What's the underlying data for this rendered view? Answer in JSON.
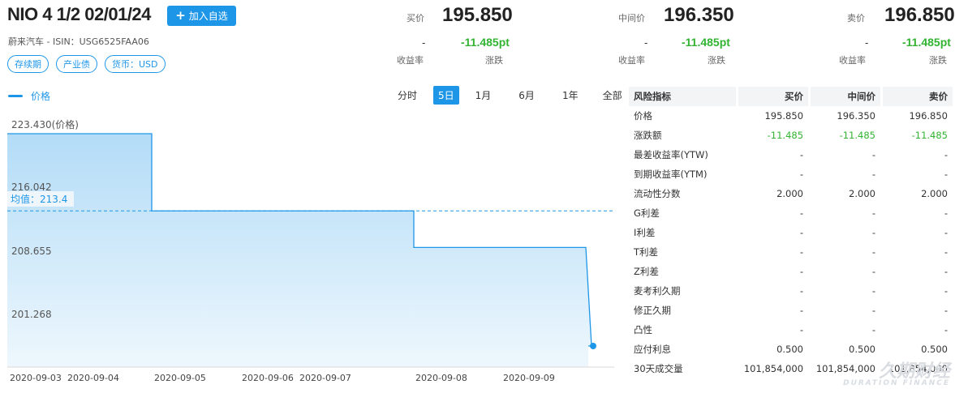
{
  "header": {
    "title": "NIO 4 1/2 02/01/24",
    "add_button": "加入自选",
    "issuer": "蔚来汽车",
    "isin_label": "ISIN：USG6525FAA06",
    "tags": [
      "存续期",
      "产业债",
      "货币：USD"
    ]
  },
  "quotes": [
    {
      "label": "买价",
      "price": "195.850",
      "yield": "-",
      "change": "-11.485pt",
      "yield_label": "收益率",
      "change_label": "涨跌"
    },
    {
      "label": "中间价",
      "price": "196.350",
      "yield": "-",
      "change": "-11.485pt",
      "yield_label": "收益率",
      "change_label": "涨跌"
    },
    {
      "label": "卖价",
      "price": "196.850",
      "yield": "-",
      "change": "-11.485pt",
      "yield_label": "收益率",
      "change_label": "涨跌"
    }
  ],
  "chart_controls": {
    "legend": "价格",
    "ranges": [
      "分时",
      "5日",
      "1月",
      "6月",
      "1年",
      "全部"
    ],
    "active_range": "5日"
  },
  "chart_data": {
    "type": "area",
    "step": true,
    "x_ticks": [
      "2020-09-03",
      "2020-09-04",
      "2020-09-05",
      "2020-09-06",
      "2020-09-07",
      "2020-09-08",
      "2020-09-09"
    ],
    "y_ticks": [
      "223.430(价格)",
      "216.042",
      "208.655",
      "201.268"
    ],
    "ylim": [
      195.85,
      223.43
    ],
    "series": [
      {
        "x": [
          "2020-09-03",
          "2020-09-05",
          "2020-09-08",
          "2020-09-09"
        ],
        "y": [
          223.43,
          213.4,
          208.655,
          195.85
        ]
      }
    ],
    "last_point": {
      "x": "2020-09-09",
      "y": 195.85
    },
    "average": {
      "label": "均值：213.4",
      "value": 213.4
    },
    "colors": {
      "line": "#1e96e8",
      "fill_top": "#b3dcf7",
      "fill_bottom": "#eef7fd"
    }
  },
  "risk_table": {
    "headers": [
      "风险指标",
      "买价",
      "中间价",
      "卖价"
    ],
    "rows": [
      [
        "价格",
        "195.850",
        "196.350",
        "196.850"
      ],
      [
        "涨跌额",
        "-11.485",
        "-11.485",
        "-11.485"
      ],
      [
        "最差收益率(YTW)",
        "-",
        "-",
        "-"
      ],
      [
        "到期收益率(YTM)",
        "-",
        "-",
        "-"
      ],
      [
        "流动性分数",
        "2.000",
        "2.000",
        "2.000"
      ],
      [
        "G利差",
        "-",
        "-",
        "-"
      ],
      [
        "I利差",
        "-",
        "-",
        "-"
      ],
      [
        "T利差",
        "-",
        "-",
        "-"
      ],
      [
        "Z利差",
        "-",
        "-",
        "-"
      ],
      [
        "麦考利久期",
        "-",
        "-",
        "-"
      ],
      [
        "修正久期",
        "-",
        "-",
        "-"
      ],
      [
        "凸性",
        "-",
        "-",
        "-"
      ],
      [
        "应付利息",
        "0.500",
        "0.500",
        "0.500"
      ],
      [
        "30天成交量",
        "101,854,000",
        "101,854,000",
        "101,854,000"
      ]
    ],
    "green_row": 1
  },
  "watermark": {
    "cn": "久期财经",
    "en": "DURATION FINANCE"
  },
  "colors": {
    "accent": "#1e96e8",
    "down": "#32b332"
  }
}
